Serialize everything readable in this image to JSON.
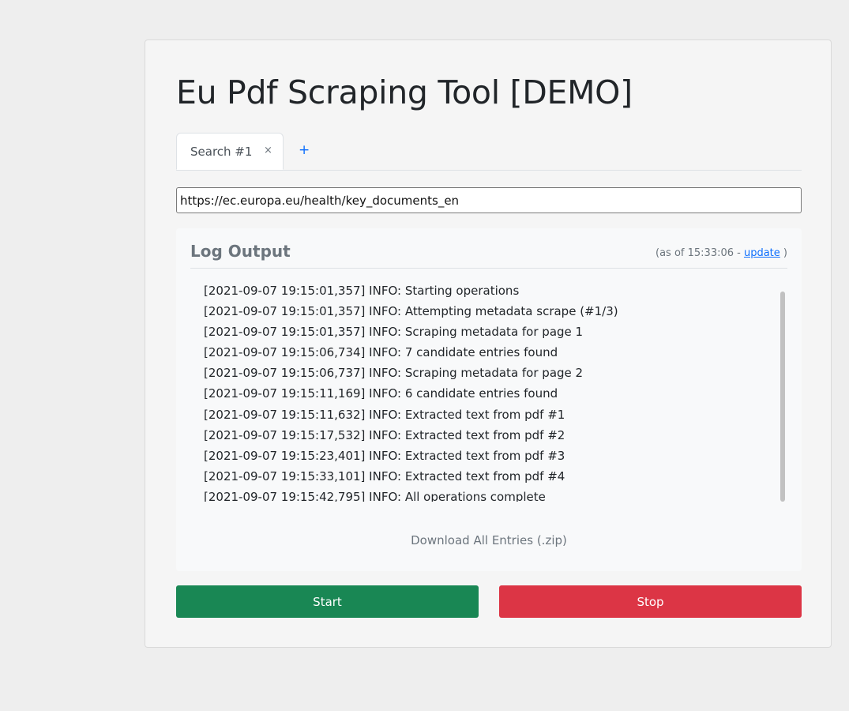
{
  "app": {
    "title": "Eu Pdf Scraping Tool [DEMO]"
  },
  "tabs": [
    {
      "label": "Search #1",
      "close_label": "×",
      "active": true
    }
  ],
  "add_tab_label": "+",
  "url_input": {
    "value": "https://ec.europa.eu/health/key_documents_en"
  },
  "log": {
    "title": "Log Output",
    "as_of_prefix": "(as of 15:33:06 - ",
    "update_label": "update",
    "as_of_suffix": " )",
    "lines": [
      "[2021-09-07 19:15:01,357] INFO: Starting operations",
      "[2021-09-07 19:15:01,357] INFO: Attempting metadata scrape (#1/3)",
      "[2021-09-07 19:15:01,357] INFO: Scraping metadata for page 1",
      "[2021-09-07 19:15:06,734] INFO: 7 candidate entries found",
      "[2021-09-07 19:15:06,737] INFO: Scraping metadata for page 2",
      "[2021-09-07 19:15:11,169] INFO: 6 candidate entries found",
      "[2021-09-07 19:15:11,632] INFO: Extracted text from pdf #1",
      "[2021-09-07 19:15:17,532] INFO: Extracted text from pdf #2",
      "[2021-09-07 19:15:23,401] INFO: Extracted text from pdf #3",
      "[2021-09-07 19:15:33,101] INFO: Extracted text from pdf #4",
      "[2021-09-07 19:15:42,795] INFO: All operations complete"
    ]
  },
  "download_label": "Download All Entries (.zip)",
  "buttons": {
    "start_label": "Start",
    "stop_label": "Stop"
  },
  "colors": {
    "start": "#198754",
    "stop": "#dc3545",
    "link": "#0d6efd"
  }
}
